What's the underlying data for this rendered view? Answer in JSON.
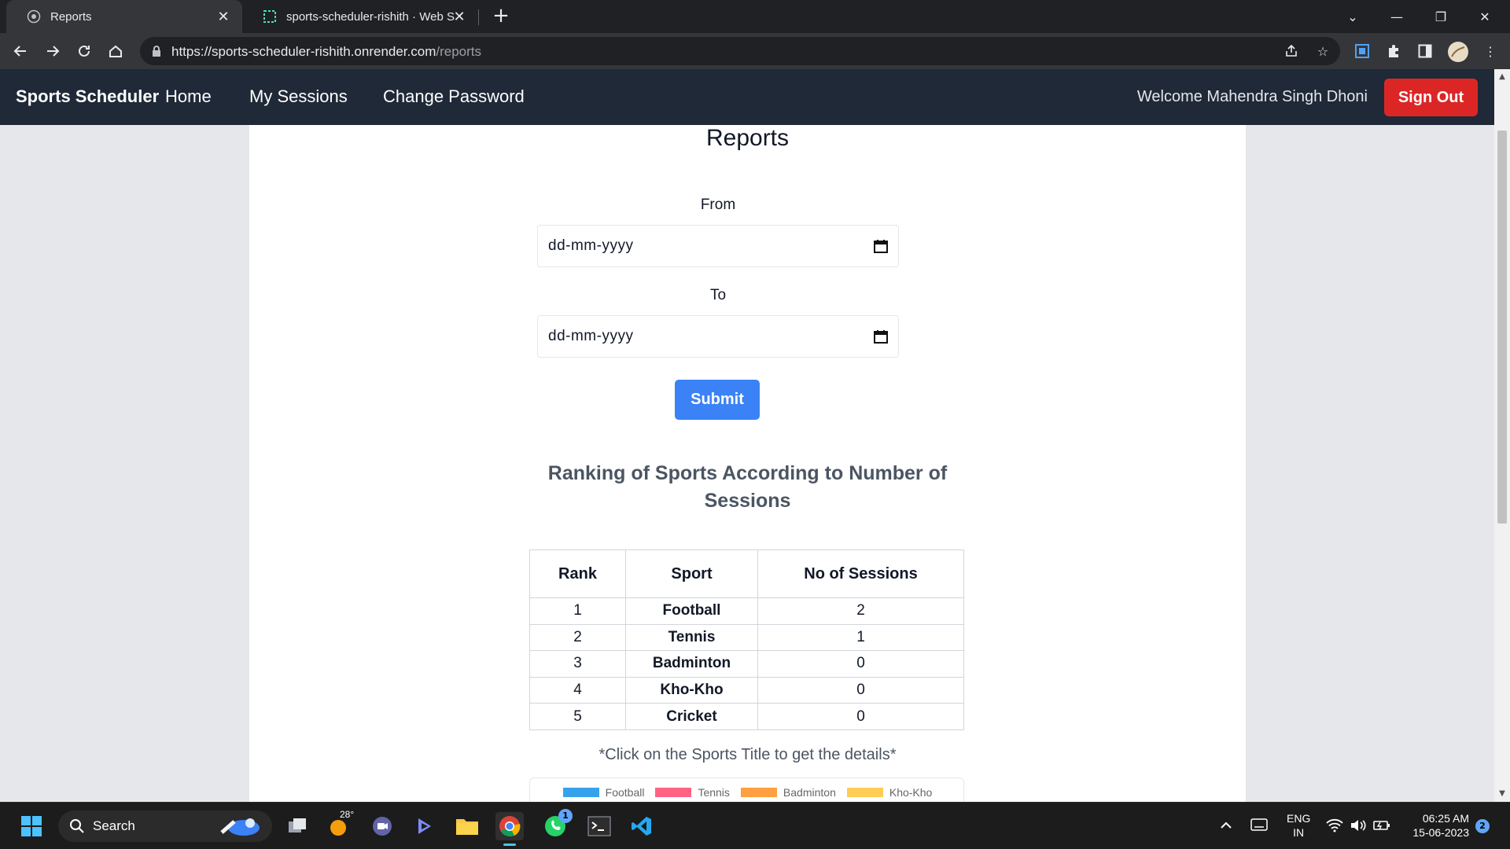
{
  "browser": {
    "tabs": [
      {
        "title": "Reports",
        "active": true
      },
      {
        "title": "sports-scheduler-rishith · Web S",
        "active": false
      }
    ],
    "url_host": "https://sports-scheduler-rishith.onrender.com",
    "url_path": "/reports"
  },
  "nav": {
    "brand": "Sports Scheduler",
    "links": [
      "Home",
      "My Sessions",
      "Change Password"
    ],
    "welcome": "Welcome Mahendra Singh Dhoni",
    "signout": "Sign Out"
  },
  "page": {
    "title": "Reports",
    "from_label": "From",
    "to_label": "To",
    "from_placeholder": "dd-mm-yyyy",
    "to_placeholder": "dd-mm-yyyy",
    "submit": "Submit",
    "ranking_title": "Ranking of Sports According to Number of Sessions",
    "table": {
      "headers": [
        "Rank",
        "Sport",
        "No of Sessions"
      ],
      "rows": [
        {
          "rank": "1",
          "sport": "Football",
          "sessions": "2"
        },
        {
          "rank": "2",
          "sport": "Tennis",
          "sessions": "1"
        },
        {
          "rank": "3",
          "sport": "Badminton",
          "sessions": "0"
        },
        {
          "rank": "4",
          "sport": "Kho-Kho",
          "sessions": "0"
        },
        {
          "rank": "5",
          "sport": "Cricket",
          "sessions": "0"
        }
      ]
    },
    "hint": "*Click on the Sports Title to get the details*",
    "legend": [
      {
        "label": "Football",
        "color": "#36a2eb"
      },
      {
        "label": "Tennis",
        "color": "#ff6384"
      },
      {
        "label": "Badminton",
        "color": "#ff9f40"
      },
      {
        "label": "Kho-Kho",
        "color": "#ffcd56"
      }
    ]
  },
  "taskbar": {
    "search": "Search",
    "weather": "28°",
    "whatsapp_badge": "1",
    "lang1": "ENG",
    "lang2": "IN",
    "time": "06:25 AM",
    "date": "15-06-2023",
    "notif": "2"
  }
}
